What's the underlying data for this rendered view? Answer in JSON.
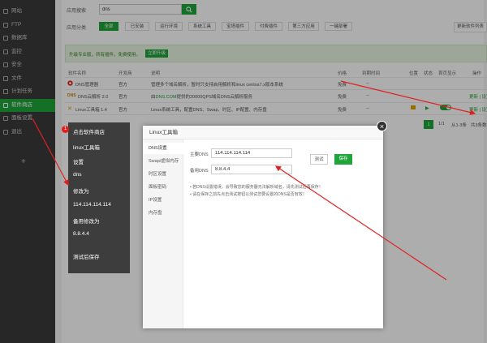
{
  "sidebar": {
    "items": [
      {
        "label": "网站",
        "icon": "globe-icon"
      },
      {
        "label": "FTP",
        "icon": "ftp-icon"
      },
      {
        "label": "数据库",
        "icon": "database-icon"
      },
      {
        "label": "监控",
        "icon": "monitor-icon"
      },
      {
        "label": "安全",
        "icon": "shield-icon"
      },
      {
        "label": "文件",
        "icon": "folder-icon"
      },
      {
        "label": "计划任务",
        "icon": "clock-icon"
      },
      {
        "label": "软件商店",
        "icon": "grid-icon"
      },
      {
        "label": "面板设置",
        "icon": "gear-icon"
      },
      {
        "label": "退出",
        "icon": "logout-icon"
      }
    ],
    "plus": "+"
  },
  "toolbar": {
    "search_label": "应用搜索",
    "search_value": "dns",
    "category_label": "应用分类",
    "categories": [
      "全部",
      "已安装",
      "运行环境",
      "系统工具",
      "宝塔插件",
      "付费插件",
      "第三方应用",
      "一键部署"
    ],
    "update_label": "更新软件列表"
  },
  "promo": {
    "text": "升级专业版，所有插件，免费使用。",
    "button": "立即升级"
  },
  "table": {
    "headers": [
      "软件名称",
      "开发商",
      "说明",
      "价格",
      "到期时间",
      "位置",
      "状态",
      "首页显示",
      "操作"
    ],
    "rows": [
      {
        "name": "DNS管理器",
        "dev": "官方",
        "desc": "管理多个域名解析，暂时只支持启用解析和linux centos7.x版本系统",
        "price": "免费",
        "expire": "--",
        "ops": ""
      },
      {
        "name": "DNS云解析 2.0",
        "dev": "官方",
        "desc_prefix": "由",
        "desc_link": "DNS.COM",
        "desc_suffix": "提供的20000QPS域名DNS云解析服务",
        "price": "免费",
        "expire": "--",
        "ops": "更新 | 设置 | 卸载"
      },
      {
        "name": "Linux工具箱 1.4",
        "dev": "官方",
        "desc": "Linux系统工具，配置DNS、Swap、时区、IP配置、内存盘",
        "price": "免费",
        "expire": "--",
        "ops": "更新 | 设置 | 卸载"
      }
    ]
  },
  "pager": {
    "page": "1",
    "total": "1/1",
    "range": "从1-3条",
    "count": "共3条数据"
  },
  "modal": {
    "title": "Linux工具箱",
    "tabs": [
      "DNS设置",
      "Swap/虚拟内存",
      "时区设置",
      "面板密码",
      "IP设置",
      "内存盘"
    ],
    "primary_label": "主要DNS",
    "primary_value": "114.114.114.114",
    "backup_label": "备用DNS",
    "backup_value": "8.8.4.4",
    "test_button": "测试",
    "save_button": "保存",
    "tips": [
      "若DNS设置错误，会导致您的服务器无法解析域名，请先测试后再保存！",
      "请在保存之前先点击测试按钮以测试您要设置的DNS是否有效！"
    ],
    "close": "×"
  },
  "guide": {
    "badge": "1",
    "lines": [
      "点击软件商店",
      "linux工具箱",
      "设置",
      "dns",
      "修改为",
      "114.114.114.114",
      "备用修改为",
      "8.8.4.4",
      "测试后保存"
    ]
  },
  "colors": {
    "accent": "#20a53a",
    "arrow": "#e02020",
    "sidebar": "#3a3a3a"
  }
}
